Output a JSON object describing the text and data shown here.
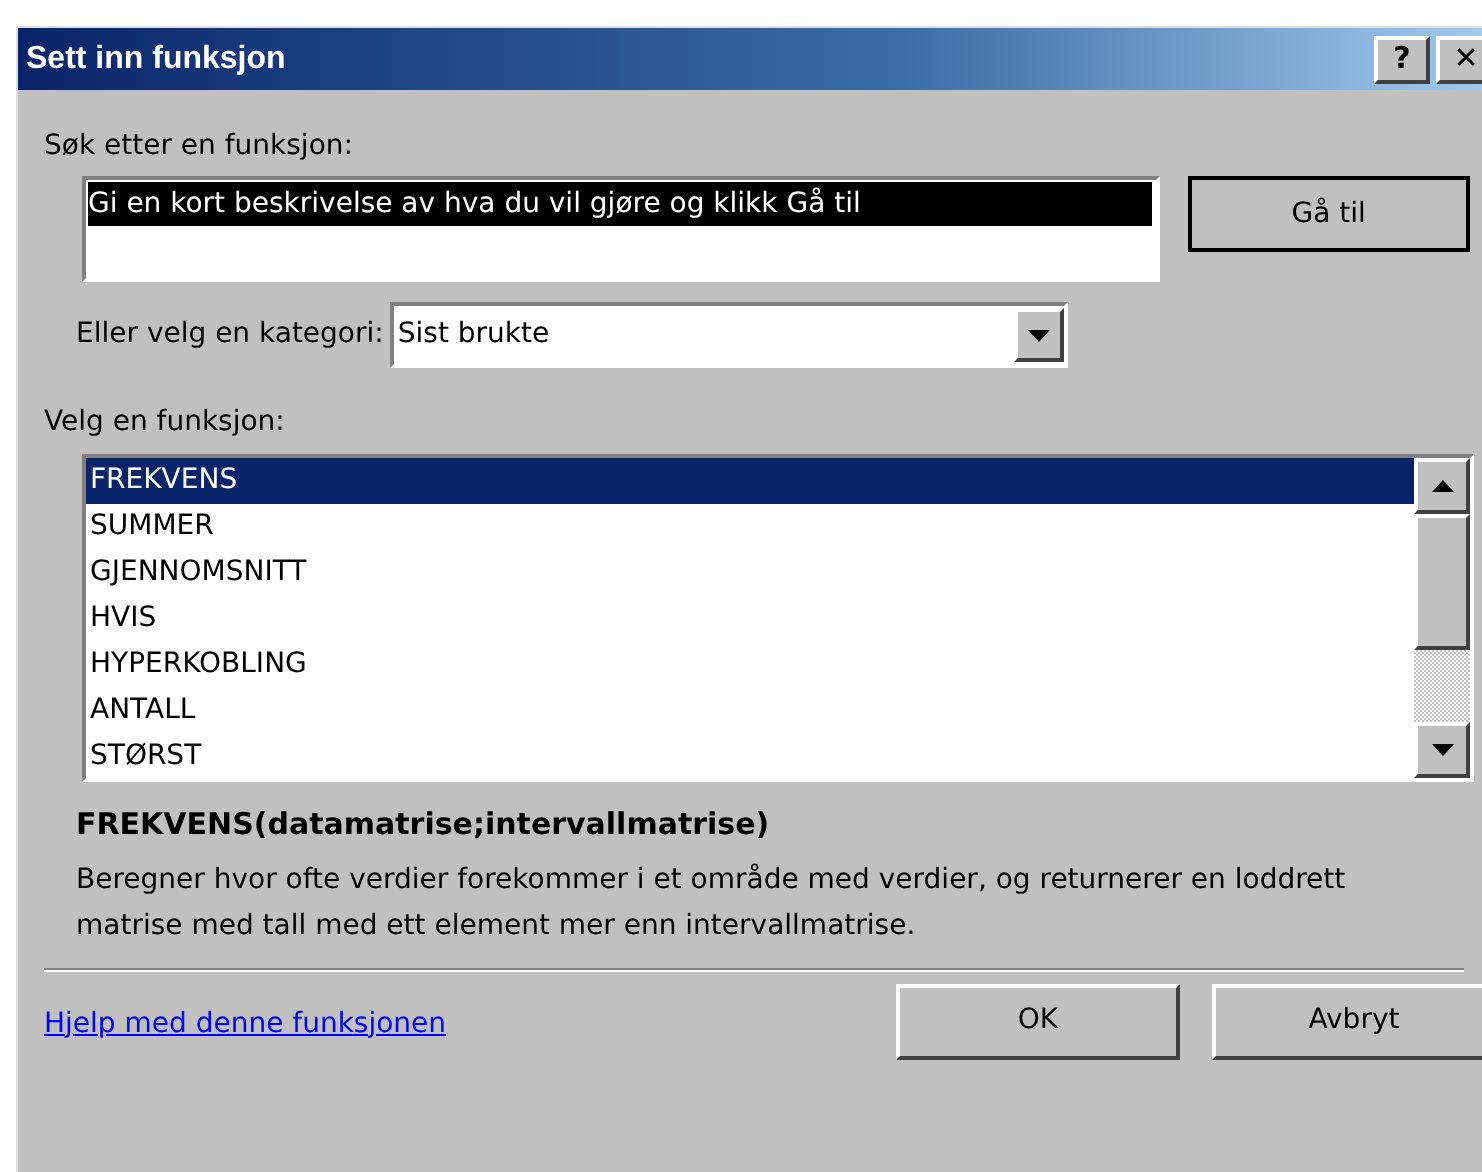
{
  "window": {
    "title": "Sett inn funksjon",
    "help_button": "?",
    "close_button": "✕"
  },
  "search": {
    "label": "Søk etter en funksjon:",
    "value": "Gi en kort beskrivelse av hva du vil gjøre og klikk Gå til",
    "button": "Gå til"
  },
  "category": {
    "label": "Eller velg en kategori:",
    "value": "Sist brukte"
  },
  "functions": {
    "label": "Velg en funksjon:",
    "items": [
      {
        "name": "FREKVENS",
        "selected": true
      },
      {
        "name": "SUMMER",
        "selected": false
      },
      {
        "name": "GJENNOMSNITT",
        "selected": false
      },
      {
        "name": "HVIS",
        "selected": false
      },
      {
        "name": "HYPERKOBLING",
        "selected": false
      },
      {
        "name": "ANTALL",
        "selected": false
      },
      {
        "name": "STØRST",
        "selected": false
      }
    ]
  },
  "signature": "FREKVENS(datamatrise;intervallmatrise)",
  "description": "Beregner hvor ofte verdier forekommer i et område med verdier, og returnerer en loddrett matrise med tall med ett element mer enn intervallmatrise.",
  "help_link": "Hjelp med denne funksjonen",
  "buttons": [
    "OK",
    "Avbryt"
  ]
}
